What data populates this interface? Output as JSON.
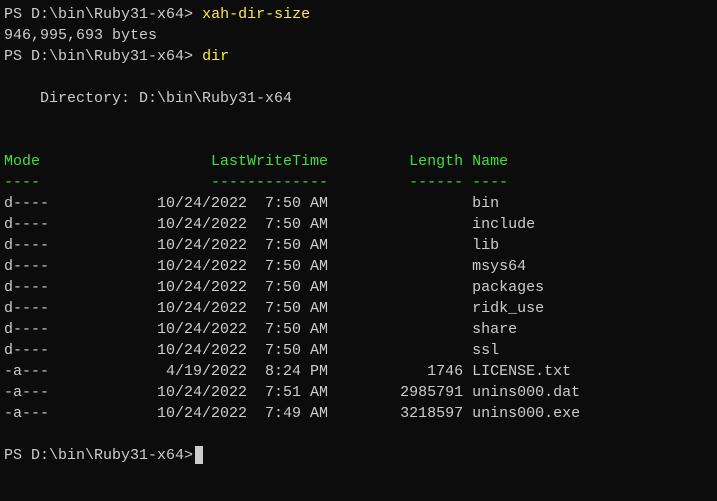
{
  "prompts": [
    {
      "prefix": "PS ",
      "path": "D:\\bin\\Ruby31-x64",
      "caret": "> ",
      "command": "xah-dir-size"
    },
    {
      "prefix": "PS ",
      "path": "D:\\bin\\Ruby31-x64",
      "caret": "> ",
      "command": "dir"
    },
    {
      "prefix": "PS ",
      "path": "D:\\bin\\Ruby31-x64",
      "caret": ">",
      "command": ""
    }
  ],
  "sizeOutput": "946,995,693 bytes",
  "directoryLabel": "    Directory: ",
  "directoryPath": "D:\\bin\\Ruby31-x64",
  "headers": {
    "mode": "Mode",
    "lwt": "LastWriteTime",
    "length": "Length",
    "name": "Name"
  },
  "dashes": {
    "mode": "----",
    "lwt": "-------------",
    "length": "------",
    "name": "----"
  },
  "padding": {
    "mode": "             ",
    "lwtGap": "    ",
    "lenGap": " ",
    "nameGap": " "
  },
  "rows": [
    {
      "mode": "d----",
      "date": "10/24/2022",
      "time": " 7:50 AM",
      "length": "",
      "name": "bin"
    },
    {
      "mode": "d----",
      "date": "10/24/2022",
      "time": " 7:50 AM",
      "length": "",
      "name": "include"
    },
    {
      "mode": "d----",
      "date": "10/24/2022",
      "time": " 7:50 AM",
      "length": "",
      "name": "lib"
    },
    {
      "mode": "d----",
      "date": "10/24/2022",
      "time": " 7:50 AM",
      "length": "",
      "name": "msys64"
    },
    {
      "mode": "d----",
      "date": "10/24/2022",
      "time": " 7:50 AM",
      "length": "",
      "name": "packages"
    },
    {
      "mode": "d----",
      "date": "10/24/2022",
      "time": " 7:50 AM",
      "length": "",
      "name": "ridk_use"
    },
    {
      "mode": "d----",
      "date": "10/24/2022",
      "time": " 7:50 AM",
      "length": "",
      "name": "share"
    },
    {
      "mode": "d----",
      "date": "10/24/2022",
      "time": " 7:50 AM",
      "length": "",
      "name": "ssl"
    },
    {
      "mode": "-a---",
      "date": " 4/19/2022",
      "time": " 8:24 PM",
      "length": "1746",
      "name": "LICENSE.txt"
    },
    {
      "mode": "-a---",
      "date": "10/24/2022",
      "time": " 7:51 AM",
      "length": "2985791",
      "name": "unins000.dat"
    },
    {
      "mode": "-a---",
      "date": "10/24/2022",
      "time": " 7:49 AM",
      "length": "3218597",
      "name": "unins000.exe"
    }
  ]
}
